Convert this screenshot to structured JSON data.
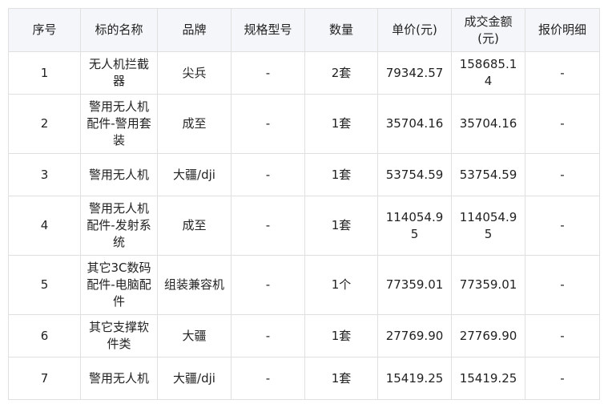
{
  "headers": [
    "序号",
    "标的名称",
    "品牌",
    "规格型号",
    "数量",
    "单价(元)",
    "成交金额(元)",
    "报价明细"
  ],
  "rows": [
    {
      "index": "1",
      "name": "无人机拦截器",
      "brand": "尖兵",
      "model": "-",
      "qty": "2套",
      "unit_price": "79342.57",
      "amount": "158685.14",
      "detail": "-"
    },
    {
      "index": "2",
      "name": "警用无人机配件-警用套装",
      "brand": "成至",
      "model": "-",
      "qty": "1套",
      "unit_price": "35704.16",
      "amount": "35704.16",
      "detail": "-"
    },
    {
      "index": "3",
      "name": "警用无人机",
      "brand": "大疆/dji",
      "model": "-",
      "qty": "1套",
      "unit_price": "53754.59",
      "amount": "53754.59",
      "detail": "-"
    },
    {
      "index": "4",
      "name": "警用无人机配件-发射系统",
      "brand": "成至",
      "model": "-",
      "qty": "1套",
      "unit_price": "114054.95",
      "amount": "114054.95",
      "detail": "-"
    },
    {
      "index": "5",
      "name": "其它3C数码配件-电脑配件",
      "brand": "组装兼容机",
      "model": "-",
      "qty": "1个",
      "unit_price": "77359.01",
      "amount": "77359.01",
      "detail": "-"
    },
    {
      "index": "6",
      "name": "其它支撑软件类",
      "brand": "大疆",
      "model": "-",
      "qty": "1套",
      "unit_price": "27769.90",
      "amount": "27769.90",
      "detail": "-"
    },
    {
      "index": "7",
      "name": "警用无人机",
      "brand": "大疆/dji",
      "model": "-",
      "qty": "1套",
      "unit_price": "15419.25",
      "amount": "15419.25",
      "detail": "-"
    }
  ]
}
